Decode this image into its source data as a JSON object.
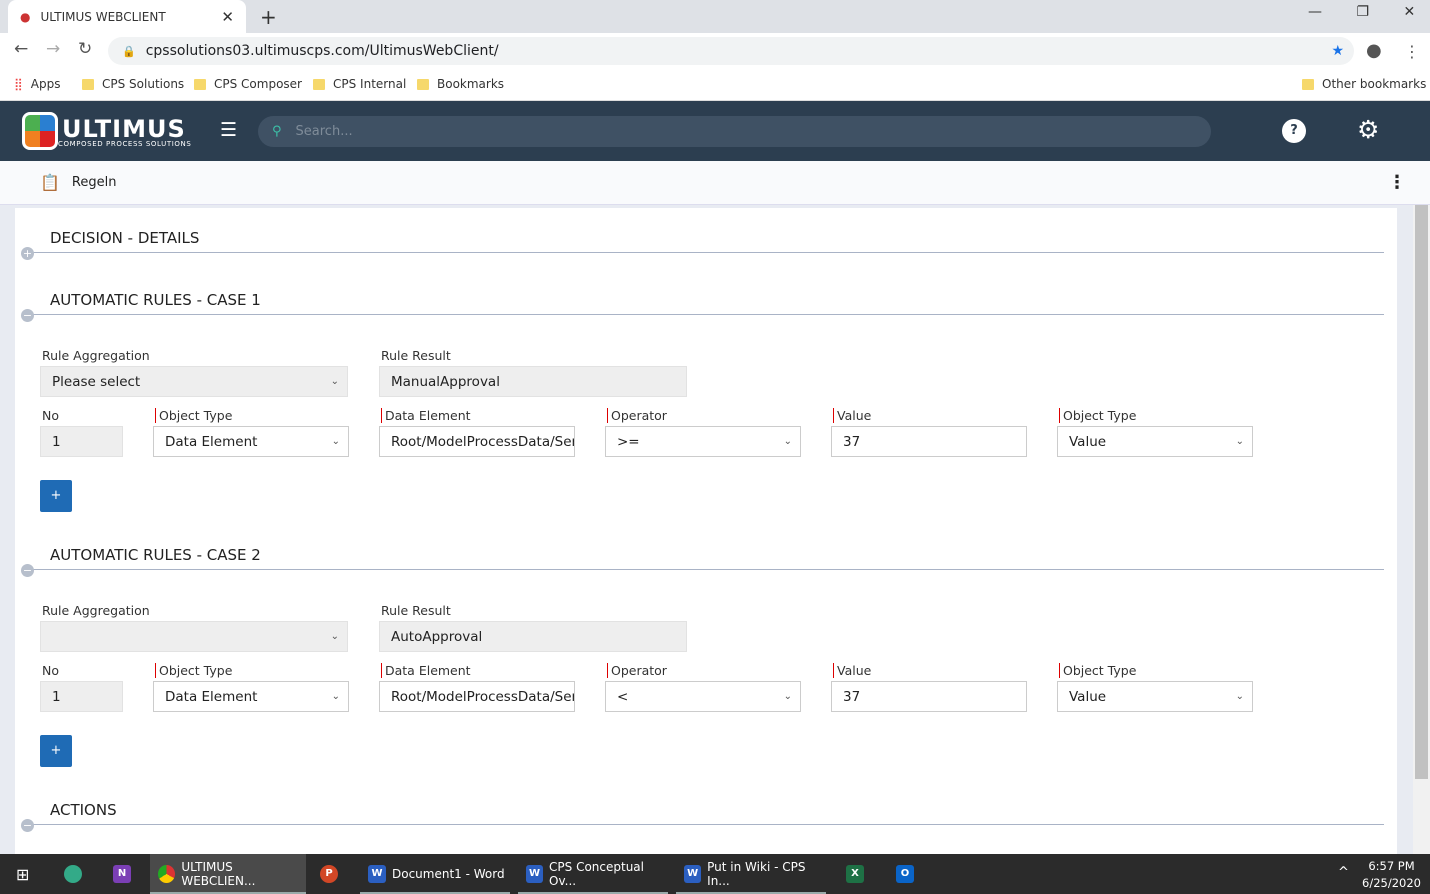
{
  "browser": {
    "tab_title": "ULTIMUS WEBCLIENT",
    "url": "cpssolutions03.ultimuscps.com/UltimusWebClient/",
    "bookmarks": [
      "Apps",
      "CPS Solutions",
      "CPS Composer",
      "CPS Internal",
      "Bookmarks"
    ],
    "other_bookmarks": "Other bookmarks"
  },
  "header": {
    "logo": "ULTIMUS",
    "logo_sub": "COMPOSED PROCESS SOLUTIONS",
    "search_placeholder": "Search..."
  },
  "subheader": {
    "title": "Regeln"
  },
  "sections": {
    "decision": "DECISION - DETAILS",
    "case1": "AUTOMATIC RULES - CASE 1",
    "case2": "AUTOMATIC RULES - CASE 2",
    "actions": "ACTIONS"
  },
  "labels": {
    "rule_aggregation": "Rule Aggregation",
    "rule_result": "Rule Result",
    "no": "No",
    "object_type": "Object Type",
    "data_element": "Data Element",
    "operator": "Operator",
    "value": "Value",
    "add": "+"
  },
  "case1": {
    "rule_aggregation": "Please select",
    "rule_result": "ManualApproval",
    "no": "1",
    "object_type": "Data Element",
    "data_element": "Root/ModelProcessData/Service",
    "operator": ">=",
    "value": "37",
    "value_type": "Value"
  },
  "case2": {
    "rule_aggregation": "",
    "rule_result": "AutoApproval",
    "no": "1",
    "object_type": "Data Element",
    "data_element": "Root/ModelProcessData/Service",
    "operator": "<",
    "value": "37",
    "value_type": "Value"
  },
  "taskbar": {
    "items": [
      "ULTIMUS WEBCLIEN...",
      "Document1 - Word",
      "CPS Conceptual Ov...",
      "Put in Wiki - CPS In..."
    ],
    "time": "6:57 PM",
    "date": "6/25/2020"
  },
  "colors": {
    "header": "#2c3e50",
    "button": "#1f6bb5"
  }
}
